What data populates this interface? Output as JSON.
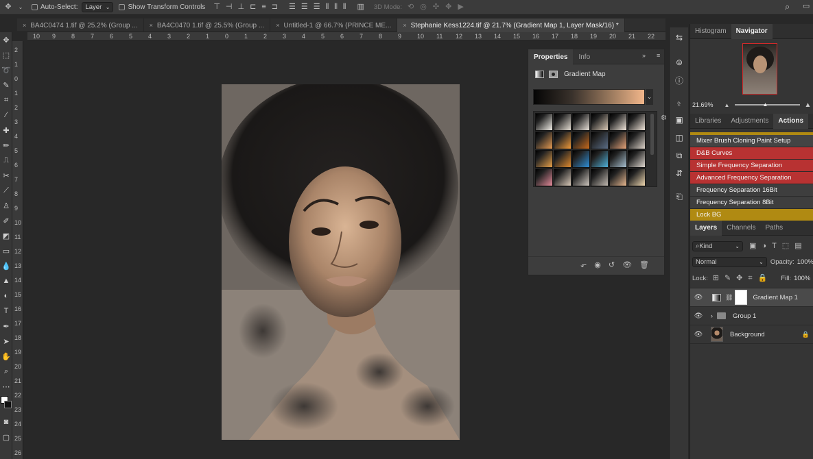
{
  "options_bar": {
    "auto_select_label": "Auto-Select:",
    "auto_select_value": "Layer",
    "show_transform_label": "Show Transform Controls",
    "mode_3d_label": "3D Mode:"
  },
  "document_tabs": [
    {
      "label": "BA4C0474 1.tif @ 25.2% (Group ...",
      "active": false
    },
    {
      "label": "BA4C0470 1.tif @ 25.5% (Group ...",
      "active": false
    },
    {
      "label": "Untitled-1 @ 66.7% (PRINCE ME...",
      "active": false
    },
    {
      "label": "Stephanie Kess1224.tif @ 21.7% (Gradient Map 1, Layer Mask/16) *",
      "active": true
    }
  ],
  "ruler_top": [
    "10",
    "9",
    "8",
    "7",
    "6",
    "5",
    "4",
    "3",
    "2",
    "1",
    "0",
    "1",
    "2",
    "3",
    "4",
    "5",
    "6",
    "7",
    "8",
    "9",
    "10",
    "11",
    "12",
    "13",
    "14",
    "15",
    "16",
    "17",
    "18",
    "19",
    "20",
    "21",
    "22"
  ],
  "ruler_left": [
    "2",
    "1",
    "0",
    "1",
    "2",
    "3",
    "4",
    "5",
    "6",
    "7",
    "8",
    "9",
    "10",
    "11",
    "12",
    "13",
    "14",
    "15",
    "16",
    "17",
    "18",
    "19",
    "20",
    "21",
    "22",
    "23",
    "24",
    "25",
    "26",
    "27"
  ],
  "properties_panel": {
    "tabs": [
      "Properties",
      "Info"
    ],
    "title": "Gradient Map",
    "swatches": [
      [
        "#f2efe8",
        "#e4ddd2",
        "#e8e0d8",
        "#d8c7b4",
        "#f3e8dc",
        "#efe4d8"
      ],
      [
        "#e49a52",
        "#f09a3a",
        "#c86a1c",
        "#5a6d86",
        "#e8a57a",
        "#dcd2c8"
      ],
      [
        "#e7a049",
        "#e08a2e",
        "#2f8fd8",
        "#4fb0d8",
        "#a8c0d0",
        "#e0d8d0"
      ],
      [
        "#e48a9a",
        "#d8c8b8",
        "#d0c8c0",
        "#c0b8b0",
        "#e8b890",
        "#f0d8b0"
      ]
    ]
  },
  "right_panel": {
    "top_tabs": [
      "Histogram",
      "Navigator"
    ],
    "zoom": "21.69%",
    "mid_tabs": [
      "Libraries",
      "Adjustments",
      "Actions"
    ],
    "actions": [
      {
        "label": "Mixer Brush Cloning Paint Setup",
        "color": "#444444"
      },
      {
        "label": "D&B Curves",
        "color": "#b83232"
      },
      {
        "label": "Simple Frequency Separation",
        "color": "#b83232"
      },
      {
        "label": "Advanced Frequency Separation",
        "color": "#b83232"
      },
      {
        "label": "Frequency Separation 16Bit",
        "color": "#3e3e3e"
      },
      {
        "label": "Frequency Separation 8Bit",
        "color": "#3e3e3e"
      },
      {
        "label": "Lock BG",
        "color": "#b08a12"
      }
    ],
    "layer_tabs": [
      "Layers",
      "Channels",
      "Paths"
    ],
    "kind_label": "Kind",
    "blend_mode": "Normal",
    "opacity_label": "Opacity:",
    "opacity_value": "100%",
    "lock_label": "Lock:",
    "fill_label": "Fill:",
    "fill_value": "100%",
    "layers": [
      {
        "name": "Gradient Map 1"
      },
      {
        "name": "Group 1"
      },
      {
        "name": "Background"
      }
    ]
  }
}
